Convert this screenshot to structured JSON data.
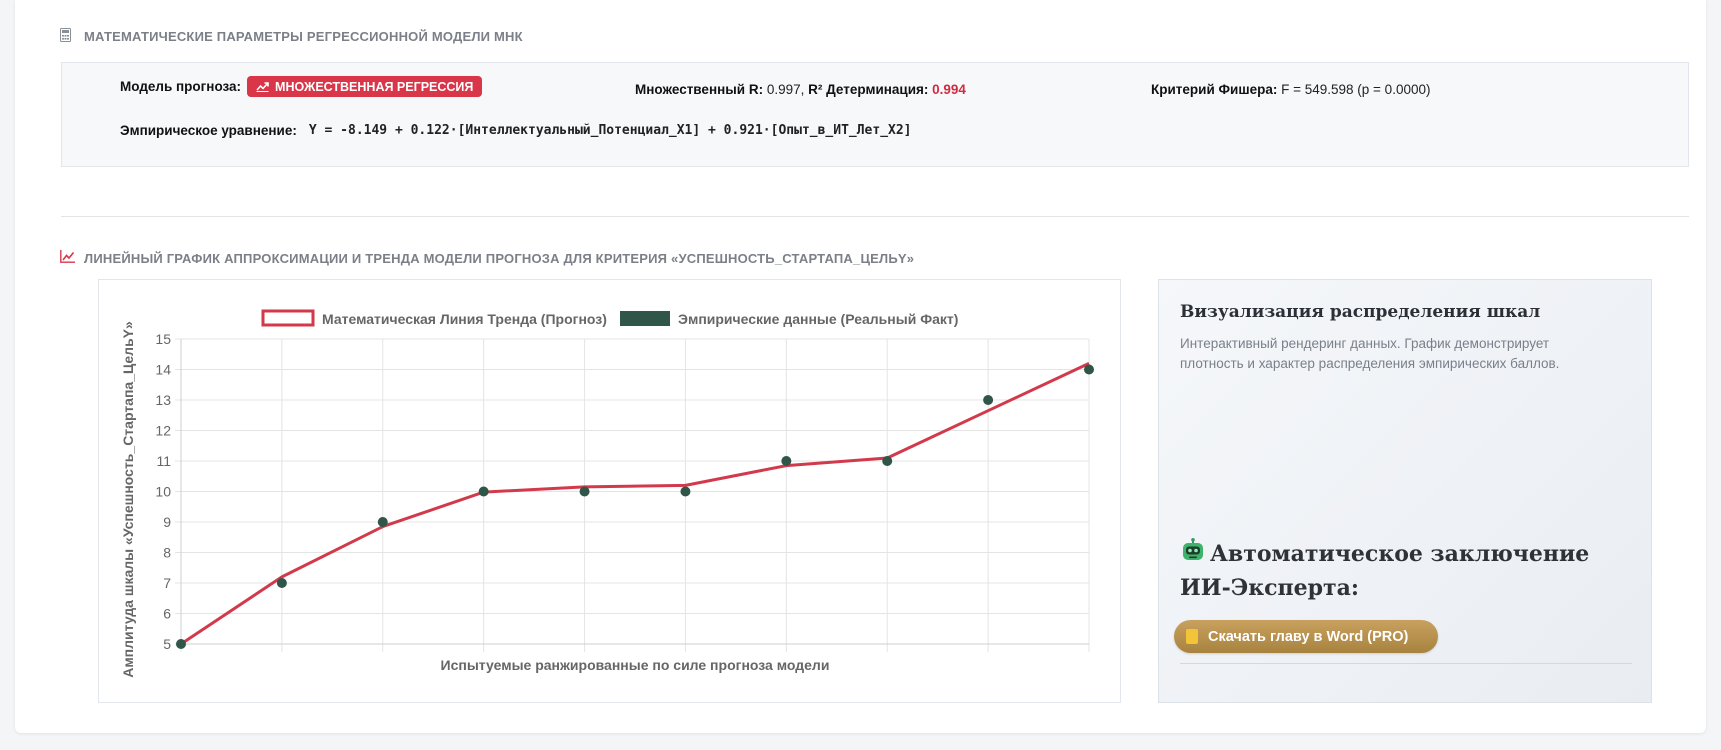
{
  "sections": {
    "params_title": "МАТЕМАТИЧЕСКИЕ ПАРАМЕТРЫ РЕГРЕССИОННОЙ МОДЕЛИ МНК",
    "chart_title": "ЛИНЕЙНЫЙ ГРАФИК АППРОКСИМАЦИИ И ТРЕНДА МОДЕЛИ ПРОГНОЗА ДЛЯ КРИТЕРИЯ «УСПЕШНОСТЬ_СТАРТАПА_ЦЕЛЬY»"
  },
  "params": {
    "model_label": "Модель прогноза:",
    "model_badge": "МНОЖЕСТВЕННАЯ РЕГРЕССИЯ",
    "multiple_r_label": "Множественный R:",
    "multiple_r_value": "0.997,",
    "r2_label": "R² Детерминация:",
    "r2_value": "0.994",
    "fisher_label": "Критерий Фишера:",
    "fisher_value": "F = 549.598 (p = 0.0000)",
    "equation_label": "Эмпирическое уравнение:",
    "equation_value": "Y = -8.149 + 0.122·[Интеллектуальный_Потенциал_X1] + 0.921·[Опыт_в_ИТ_Лет_X2]",
    "accent_color": "#d9364a"
  },
  "ai_panel": {
    "heading": "Визуализация распределения шкал",
    "description": "Интерактивный рендеринг данных. График демонстрирует плотность и характер распределения эмпирических баллов.",
    "conclusion_title": "Автоматическое заключение ИИ-Эксперта:",
    "robot_icon": "robot-icon",
    "download_button": "Скачать главу в Word (PRO)",
    "button_color": "#b8914d"
  },
  "chart_data": {
    "type": "line",
    "xlabel": "Испытуемые ранжированные по силе прогноза модели",
    "ylabel": "Амплитуда шкалы «Успешность_Стартапа_ЦельY»",
    "ylim": [
      5,
      15
    ],
    "yticks": [
      "5",
      "6",
      "7",
      "8",
      "9",
      "10",
      "11",
      "12",
      "13",
      "14",
      "15"
    ],
    "x": [
      1,
      2,
      3,
      4,
      5,
      6,
      7,
      8,
      9,
      10
    ],
    "legend_position": "top",
    "grid": true,
    "series": [
      {
        "name": "Математическая Линия Тренда (Прогноз)",
        "kind": "line",
        "color": "#d23a4c",
        "values": [
          5.0,
          7.2,
          8.85,
          9.98,
          10.15,
          10.2,
          10.85,
          11.1,
          12.65,
          14.2
        ]
      },
      {
        "name": "Эмпирические данные (Реальный Факт)",
        "kind": "scatter",
        "color": "#2f5649",
        "values": [
          5,
          7,
          9,
          10,
          10,
          10,
          11,
          11,
          13,
          14
        ]
      }
    ]
  }
}
